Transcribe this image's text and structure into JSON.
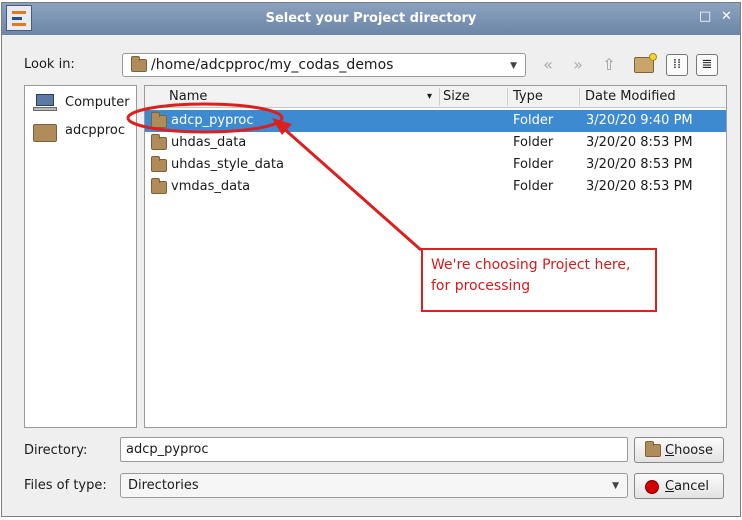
{
  "window": {
    "title": "Select your Project directory",
    "restore_glyph": "□",
    "close_glyph": "✕"
  },
  "look_in": {
    "label": "Look in:",
    "path": "/home/adcpproc/my_codas_demos"
  },
  "toolbar": {
    "icons": [
      "back-icon",
      "forward-icon",
      "parent-folder-icon",
      "new-folder-icon",
      "list-view-icon",
      "detail-view-icon"
    ]
  },
  "places": [
    {
      "label": "Computer",
      "icon": "computer-icon"
    },
    {
      "label": "adcpproc",
      "icon": "folder-icon"
    }
  ],
  "file_list": {
    "columns": [
      "Name",
      "Size",
      "Type",
      "Date Modified"
    ],
    "sort_indicator": "▾",
    "rows": [
      {
        "name": "adcp_pyproc",
        "size": "",
        "type": "Folder",
        "modified": "3/20/20 9:40 PM",
        "selected": true
      },
      {
        "name": "uhdas_data",
        "size": "",
        "type": "Folder",
        "modified": "3/20/20 8:53 PM",
        "selected": false
      },
      {
        "name": "uhdas_style_data",
        "size": "",
        "type": "Folder",
        "modified": "3/20/20 8:53 PM",
        "selected": false
      },
      {
        "name": "vmdas_data",
        "size": "",
        "type": "Folder",
        "modified": "3/20/20 8:53 PM",
        "selected": false
      }
    ]
  },
  "directory": {
    "label": "Directory:",
    "value": "adcp_pyproc"
  },
  "files_of_type": {
    "label": "Files of type:",
    "value": "Directories"
  },
  "buttons": {
    "choose_first": "C",
    "choose_rest": "hoose",
    "cancel_first": "C",
    "cancel_rest": "ancel"
  },
  "annotation": {
    "line1": "We're choosing Project here,",
    "line2": "for processing",
    "color": "#dd1f1f"
  }
}
